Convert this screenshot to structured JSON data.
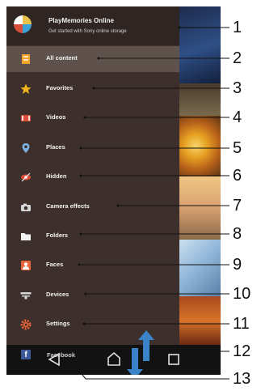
{
  "header": {
    "title": "PlayMemories Online",
    "subtitle": "Get started with Sony online storage",
    "logo_icon": "playmemories-logo-icon"
  },
  "menu": {
    "items": [
      {
        "label": "All content",
        "icon": "all-content-icon",
        "active": true
      },
      {
        "label": "Favorites",
        "icon": "star-icon"
      },
      {
        "label": "Videos",
        "icon": "video-icon"
      },
      {
        "label": "Places",
        "icon": "location-pin-icon"
      },
      {
        "label": "Hidden",
        "icon": "hidden-eye-icon"
      },
      {
        "label": "Camera effects",
        "icon": "camera-icon"
      },
      {
        "label": "Folders",
        "icon": "folder-icon"
      },
      {
        "label": "Faces",
        "icon": "faces-icon"
      },
      {
        "label": "Devices",
        "icon": "devices-icon"
      },
      {
        "label": "Settings",
        "icon": "gear-icon"
      }
    ],
    "facebook": {
      "label": "Facebook",
      "icon": "facebook-icon"
    }
  },
  "navbar": {
    "buttons": [
      "back-icon",
      "home-icon",
      "recents-icon"
    ]
  },
  "callouts": [
    "1",
    "2",
    "3",
    "4",
    "5",
    "6",
    "7",
    "8",
    "9",
    "10",
    "11",
    "12",
    "13"
  ],
  "colors": {
    "drawer_bg": "#3d2f2b",
    "active_item": "#5f524d",
    "arrow_blue": "#3a83c9",
    "facebook_blue": "#3b5998",
    "star_yellow": "#f2b31d",
    "accent_red": "#d84c3a"
  }
}
